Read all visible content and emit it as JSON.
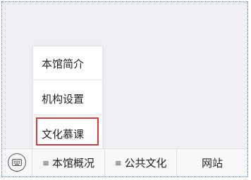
{
  "menu_popup": {
    "items": [
      {
        "label": "本馆简介"
      },
      {
        "label": "机构设置"
      },
      {
        "label": "文化慕课"
      }
    ]
  },
  "bottom_menu": {
    "keyboard_icon": "keyboard-icon",
    "tabs": [
      {
        "label": "本馆概况",
        "icon": "menu-lines-icon",
        "glyph": "≡"
      },
      {
        "label": "公共文化",
        "icon": "menu-lines-icon",
        "glyph": "≡"
      },
      {
        "label": "网站"
      }
    ]
  },
  "colors": {
    "highlight_border": "#d9393a",
    "frame_border": "#3b7bbf",
    "background": "#efeff4"
  }
}
